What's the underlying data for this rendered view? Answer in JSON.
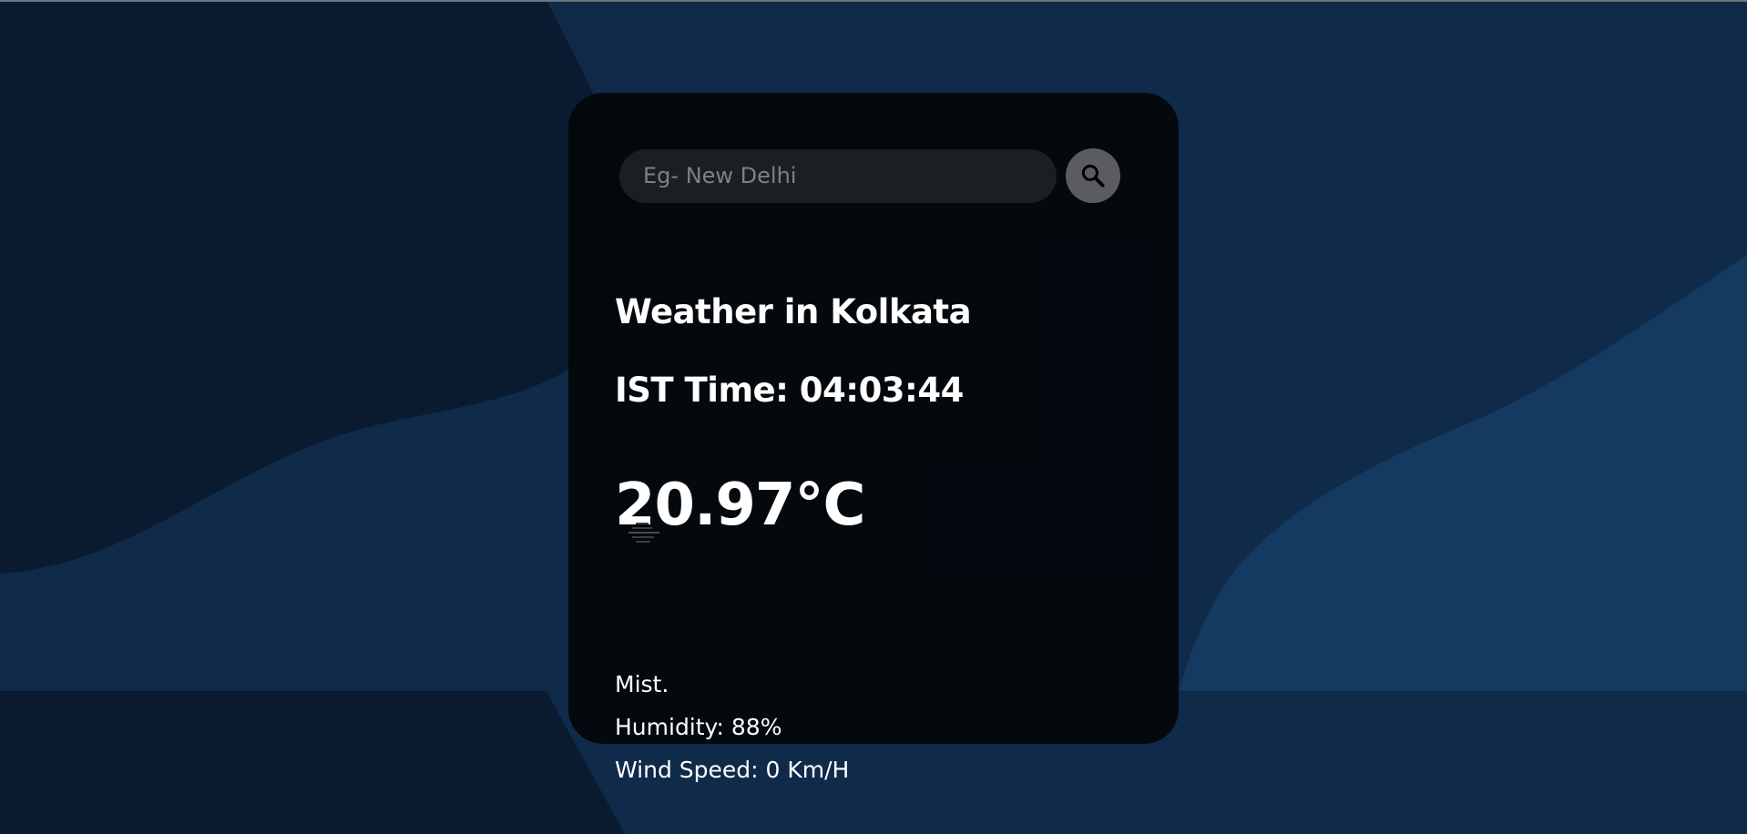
{
  "search": {
    "placeholder": "Eg- New Delhi",
    "value": ""
  },
  "weather": {
    "title": "Weather in Kolkata",
    "time": "IST Time: 04:03:44",
    "temperature": "20.97°C",
    "icon": "mist-icon",
    "description": "Mist.",
    "humidity": "Humidity: 88%",
    "wind": "Wind Speed: 0 Km/H"
  },
  "colors": {
    "background": "#102a4a",
    "card": "#03060a",
    "input": "#1b1f23",
    "button": "#5a5c5f",
    "text": "#ffffff"
  }
}
